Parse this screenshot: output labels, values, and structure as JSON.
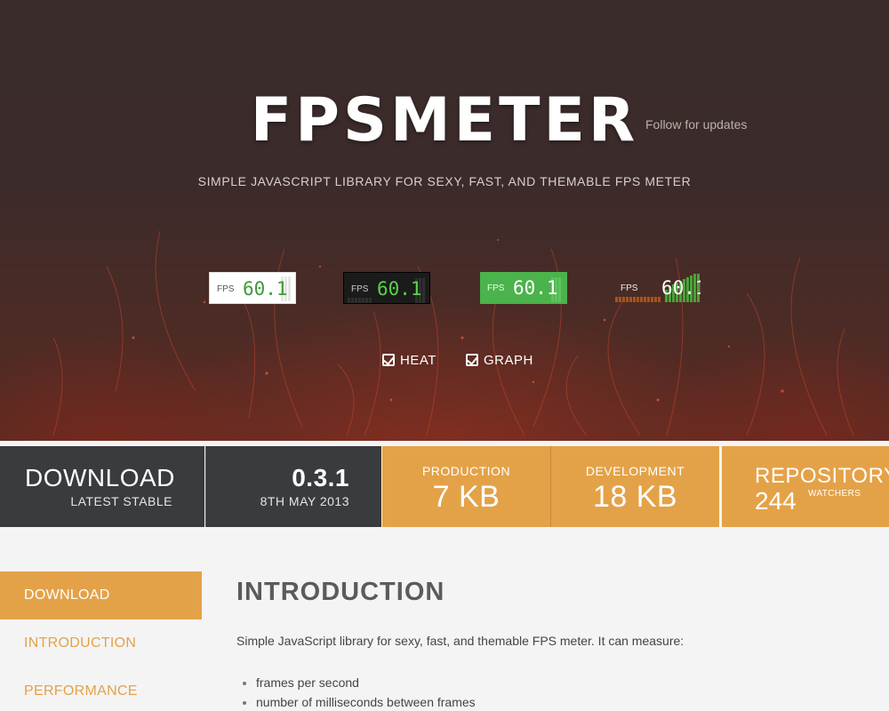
{
  "hero": {
    "title": "FPSMETER",
    "follow": "Follow for updates",
    "subtitle": "SIMPLE JAVASCRIPT LIBRARY FOR SEXY, FAST, AND THEMABLE FPS METER",
    "meters": [
      {
        "label": "FPS",
        "value": "60.1",
        "theme": "light"
      },
      {
        "label": "FPS",
        "value": "60.1",
        "theme": "dark"
      },
      {
        "label": "FPS",
        "value": "60.1",
        "theme": "colorful"
      },
      {
        "label": "FPS",
        "value": "60.1",
        "theme": "transparent"
      }
    ],
    "options": [
      {
        "label": "HEAT",
        "checked": true
      },
      {
        "label": "GRAPH",
        "checked": true
      }
    ]
  },
  "stats": {
    "download": {
      "title": "DOWNLOAD",
      "sub": "LATEST STABLE"
    },
    "version": {
      "value": "0.3.1",
      "date": "8TH MAY 2013"
    },
    "production": {
      "label": "PRODUCTION",
      "size": "7 KB"
    },
    "development": {
      "label": "DEVELOPMENT",
      "size": "18 KB"
    },
    "repository": {
      "label": "REPOSITORY",
      "watchers": "244",
      "watchers_label": "WATCHERS"
    }
  },
  "sidebar": {
    "items": [
      {
        "label": "DOWNLOAD",
        "active": true
      },
      {
        "label": "INTRODUCTION",
        "active": false
      },
      {
        "label": "PERFORMANCE",
        "active": false
      }
    ]
  },
  "content": {
    "heading": "INTRODUCTION",
    "intro": "Simple JavaScript library for sexy, fast, and themable FPS meter. It can measure:",
    "list": [
      "frames per second",
      "number of milliseconds between frames"
    ]
  },
  "colors": {
    "accent": "#e4a248",
    "dark": "#3a3b3f",
    "hero": "#3b2b2a"
  }
}
